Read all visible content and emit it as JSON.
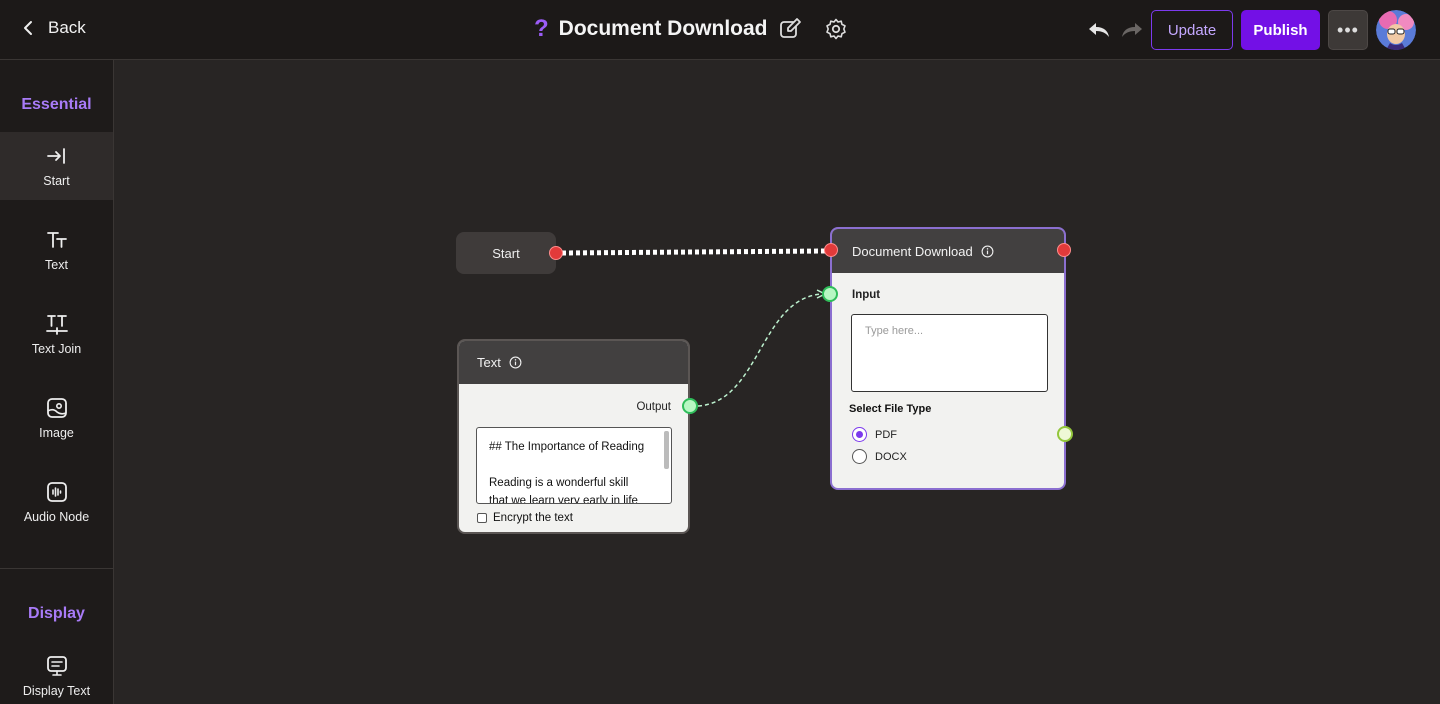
{
  "header": {
    "back_label": "Back",
    "title": "Document Download",
    "title_icon": "question-mark-icon",
    "update_label": "Update",
    "publish_label": "Publish",
    "more_label": "•••"
  },
  "sidebar": {
    "essential_title": "Essential",
    "items": [
      {
        "label": "Start",
        "icon": "arrow-right-to-bar-icon",
        "active": true
      },
      {
        "label": "Text",
        "icon": "text-icon"
      },
      {
        "label": "Text Join",
        "icon": "text-join-icon"
      },
      {
        "label": "Image",
        "icon": "image-icon"
      },
      {
        "label": "Audio Node",
        "icon": "audio-icon"
      }
    ],
    "display_title": "Display",
    "display_items": [
      {
        "label": "Display Text",
        "icon": "display-text-icon"
      }
    ]
  },
  "canvas": {
    "start_node": {
      "label": "Start"
    },
    "text_node": {
      "title": "Text",
      "output_label": "Output",
      "content_line1": "## The Importance of Reading",
      "content_line2": "Reading is a wonderful skill that we learn very early in life",
      "encrypt_label": "Encrypt the text"
    },
    "doc_node": {
      "title": "Document Download",
      "input_label": "Input",
      "input_placeholder": "Type here...",
      "file_type_label": "Select File Type",
      "options": [
        {
          "label": "PDF",
          "selected": true
        },
        {
          "label": "DOCX",
          "selected": false
        }
      ]
    }
  },
  "colors": {
    "accent": "#7310e6",
    "accent_light": "#a87bf7",
    "connector_red": "#e23a3a",
    "connector_green": "#2fbd5a"
  }
}
